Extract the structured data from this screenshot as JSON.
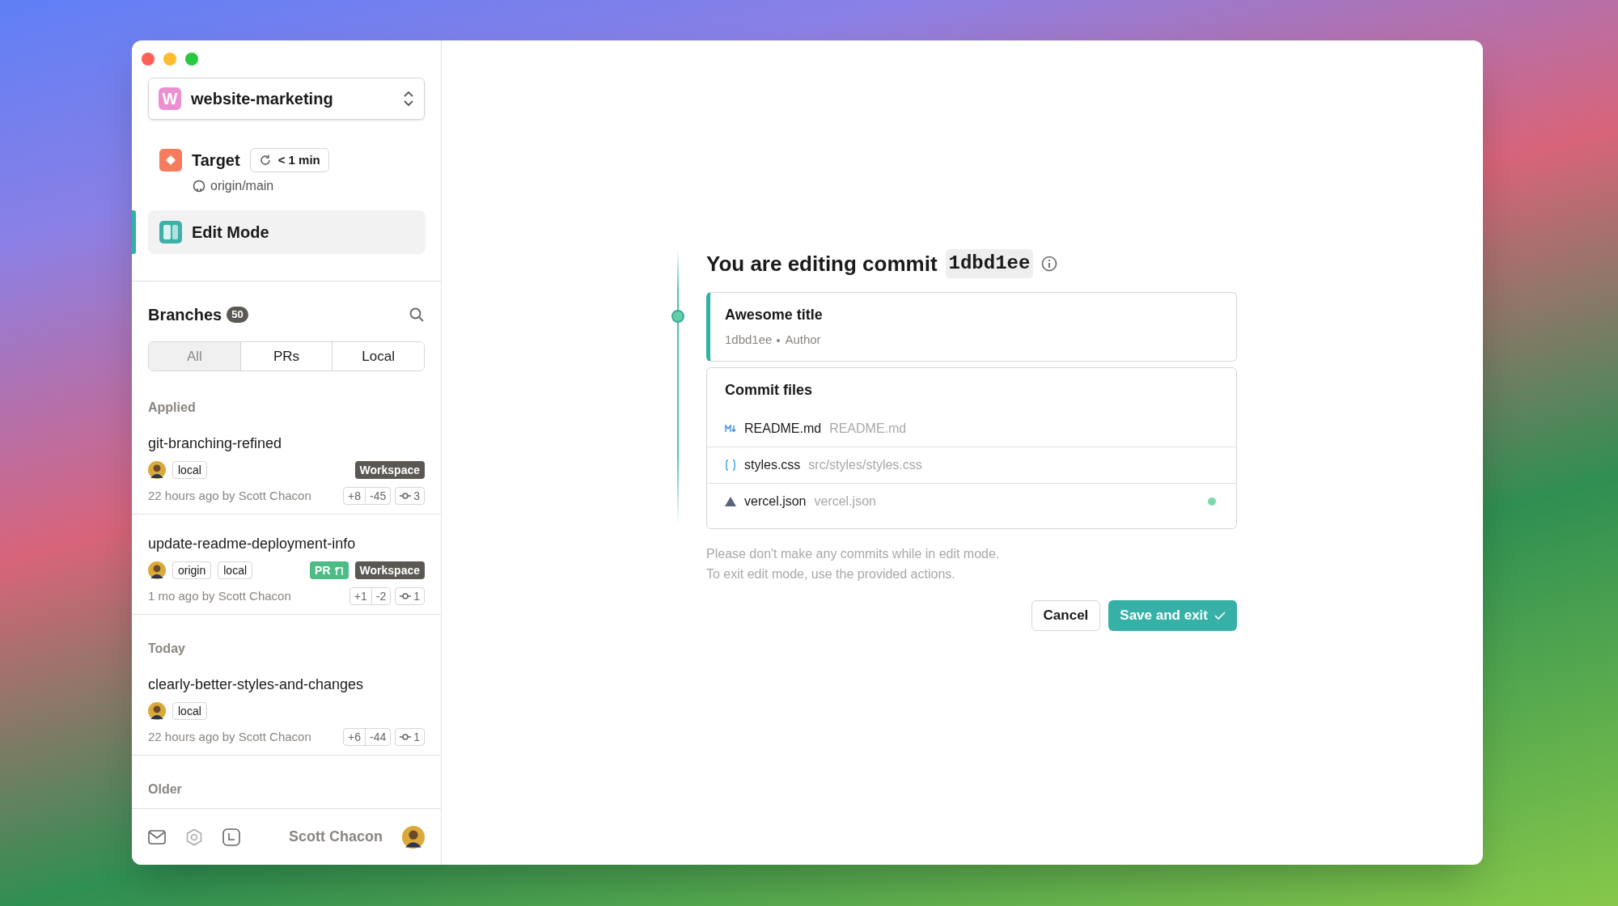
{
  "project": {
    "initial": "W",
    "name": "website-marketing"
  },
  "target": {
    "label": "Target",
    "sync": "< 1 min",
    "remote": "origin/main"
  },
  "edit_mode": {
    "label": "Edit Mode",
    "selected": true
  },
  "branches": {
    "title": "Branches",
    "count": "50",
    "filters": [
      {
        "label": "All",
        "selected": true
      },
      {
        "label": "PRs",
        "selected": false
      },
      {
        "label": "Local",
        "selected": false
      }
    ],
    "groups": [
      {
        "label": "Applied",
        "items": [
          {
            "name": "git-branching-refined",
            "tags": [
              "local"
            ],
            "badges": [
              {
                "kind": "workspace",
                "label": "Workspace"
              }
            ],
            "meta": "22 hours ago by Scott Chacon",
            "additions": "+8",
            "deletions": "-45",
            "commits": "3"
          },
          {
            "name": "update-readme-deployment-info",
            "tags": [
              "origin",
              "local"
            ],
            "badges": [
              {
                "kind": "pr",
                "label": "PR"
              },
              {
                "kind": "workspace",
                "label": "Workspace"
              }
            ],
            "meta": "1 mo ago by Scott Chacon",
            "additions": "+1",
            "deletions": "-2",
            "commits": "1"
          }
        ]
      },
      {
        "label": "Today",
        "items": [
          {
            "name": "clearly-better-styles-and-changes",
            "tags": [
              "local"
            ],
            "meta": "22 hours ago by Scott Chacon",
            "additions": "+6",
            "deletions": "-44",
            "commits": "1"
          }
        ]
      },
      {
        "label": "Older"
      }
    ]
  },
  "footer": {
    "user": "Scott Chacon"
  },
  "editor": {
    "heading": "You are editing commit",
    "commit": "1dbd1ee",
    "commit_card": {
      "title": "Awesome title",
      "hash": "1dbd1ee",
      "author": "Author"
    },
    "files": {
      "title": "Commit files",
      "items": [
        {
          "kind": "markdown",
          "name": "README.md",
          "path": "README.md",
          "modified": false
        },
        {
          "kind": "css",
          "name": "styles.css",
          "path": "src/styles/styles.css",
          "modified": false
        },
        {
          "kind": "vercel",
          "name": "vercel.json",
          "path": "vercel.json",
          "modified": true
        }
      ]
    },
    "notes": [
      "Please don't make any commits while in edit mode.",
      "To exit edit mode, use the provided actions."
    ],
    "buttons": [
      {
        "kind": "secondary",
        "label": "Cancel"
      },
      {
        "kind": "primary",
        "label": "Save and exit"
      }
    ]
  }
}
